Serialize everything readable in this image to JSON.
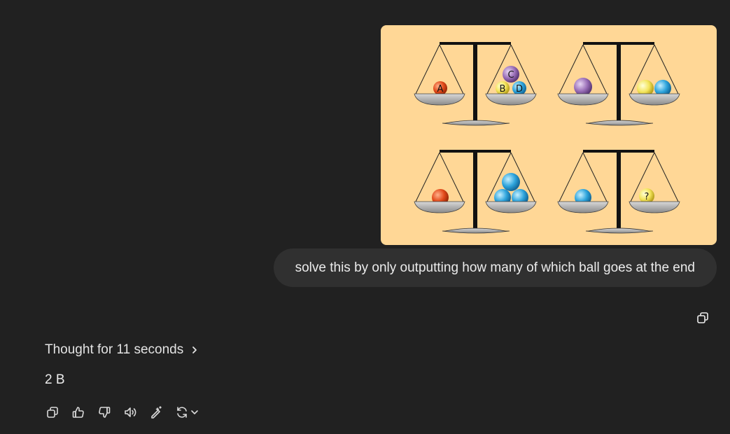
{
  "user": {
    "prompt": "solve this by only outputting how many of which ball goes at the end",
    "puzzle_labels": {
      "ball_a": "A",
      "ball_b": "B",
      "ball_c": "C",
      "ball_d": "D",
      "unknown": "?"
    }
  },
  "assistant": {
    "thought_label": "Thought for 11 seconds",
    "answer": "2 B"
  },
  "icons": {
    "copy_user": "copy-icon",
    "thought_toggle": "chevron-right-icon",
    "actions": [
      "copy-icon",
      "thumbs-up-icon",
      "thumbs-down-icon",
      "speaker-icon",
      "edit-sparkle-icon",
      "regenerate-icon"
    ]
  },
  "colors": {
    "background": "#212121",
    "bubble": "#303030",
    "image_bg": "#ffd796",
    "text": "#ececec"
  }
}
